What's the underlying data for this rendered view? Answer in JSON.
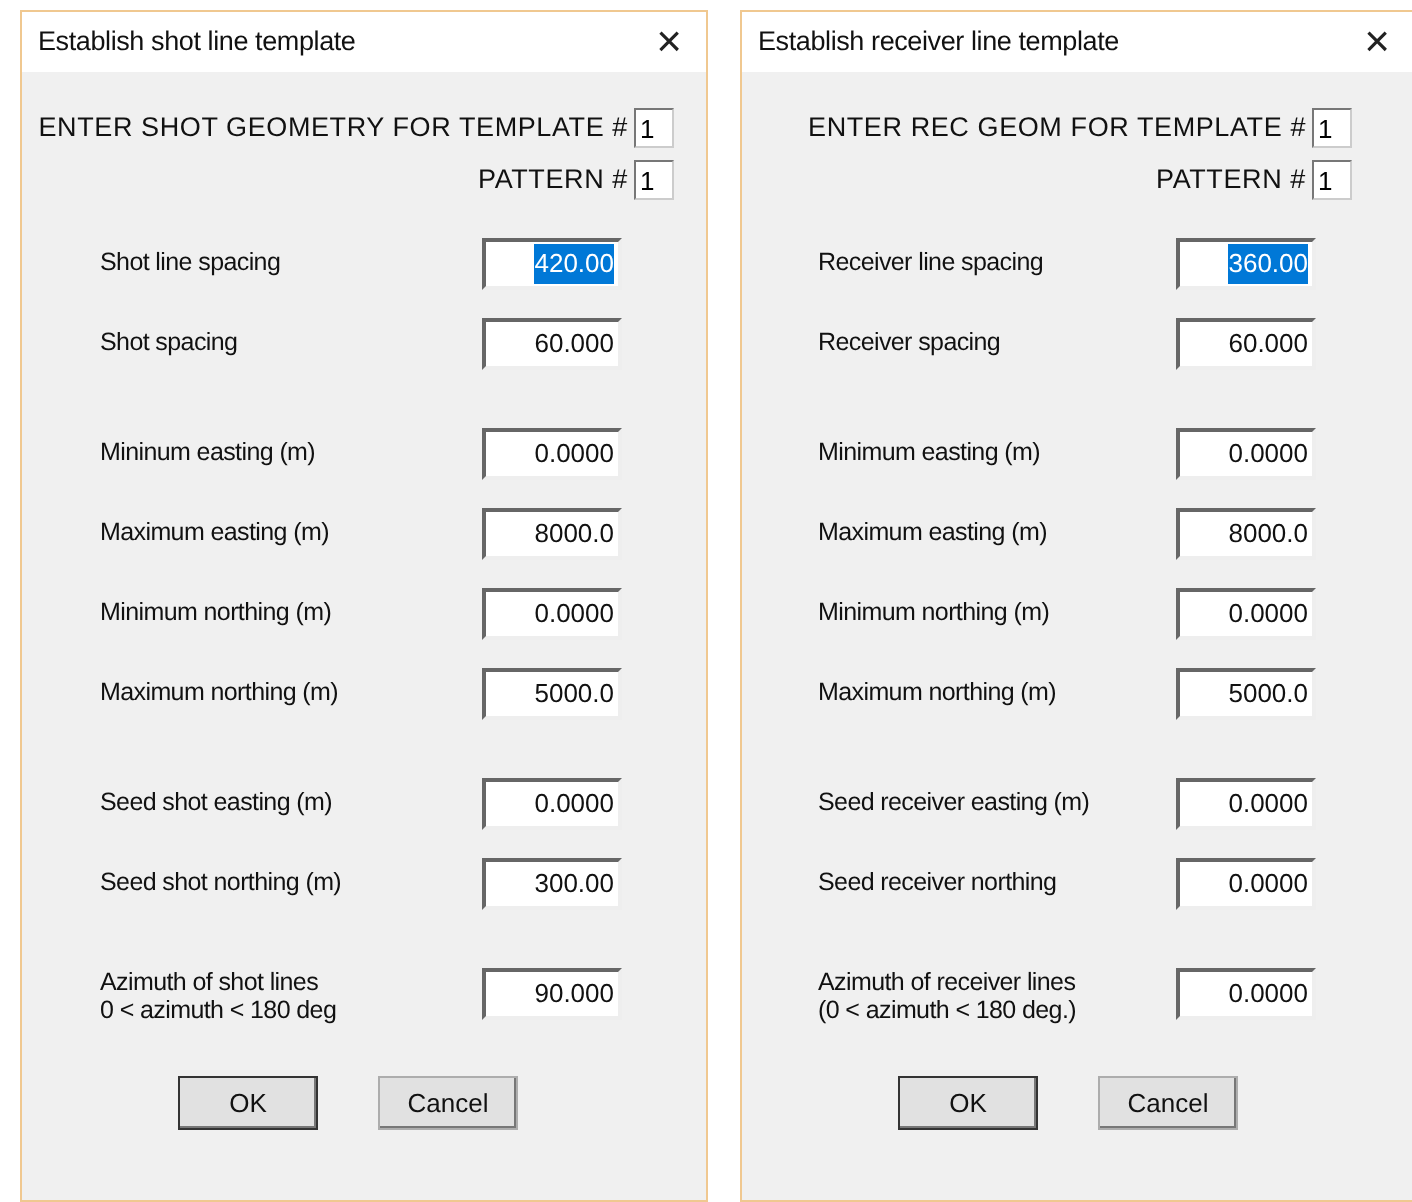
{
  "dialogs": [
    {
      "title": "Establish shot line template",
      "close": "×",
      "header": [
        {
          "label": "ENTER SHOT GEOMETRY FOR TEMPLATE #",
          "value": "1"
        },
        {
          "label": "PATTERN #",
          "value": "1"
        }
      ],
      "groups": [
        [
          {
            "label": "Shot line spacing",
            "value": "420.00",
            "selected": true
          },
          {
            "label": "Shot spacing",
            "value": "60.000",
            "selected": false
          }
        ],
        [
          {
            "label": "Mininum easting (m)",
            "value": "0.0000",
            "selected": false
          },
          {
            "label": "Maximum easting (m)",
            "value": "8000.0",
            "selected": false
          },
          {
            "label": "Minimum northing (m)",
            "value": "0.0000",
            "selected": false
          },
          {
            "label": "Maximum northing (m)",
            "value": "5000.0",
            "selected": false
          }
        ],
        [
          {
            "label": "Seed shot easting (m)",
            "value": "0.0000",
            "selected": false
          },
          {
            "label": "Seed shot northing (m)",
            "value": "300.00",
            "selected": false
          }
        ],
        [
          {
            "label": "Azimuth of shot lines\n0 < azimuth < 180 deg",
            "value": "90.000",
            "selected": false
          }
        ]
      ],
      "buttons": [
        {
          "label": "OK",
          "default": true
        },
        {
          "label": "Cancel",
          "default": false
        }
      ]
    },
    {
      "title": "Establish receiver line template",
      "close": "×",
      "header": [
        {
          "label": "ENTER REC GEOM FOR TEMPLATE #",
          "value": "1"
        },
        {
          "label": "PATTERN #",
          "value": "1"
        }
      ],
      "groups": [
        [
          {
            "label": "Receiver line spacing",
            "value": "360.00",
            "selected": true
          },
          {
            "label": "Receiver spacing",
            "value": "60.000",
            "selected": false
          }
        ],
        [
          {
            "label": "Minimum easting (m)",
            "value": "0.0000",
            "selected": false
          },
          {
            "label": "Maximum easting (m)",
            "value": "8000.0",
            "selected": false
          },
          {
            "label": "Minimum northing (m)",
            "value": "0.0000",
            "selected": false
          },
          {
            "label": "Maximum northing (m)",
            "value": "5000.0",
            "selected": false
          }
        ],
        [
          {
            "label": "Seed receiver easting (m)",
            "value": "0.0000",
            "selected": false
          },
          {
            "label": "Seed receiver northing",
            "value": "0.0000",
            "selected": false
          }
        ],
        [
          {
            "label": "Azimuth of receiver lines\n(0 < azimuth < 180 deg.)",
            "value": "0.0000",
            "selected": false
          }
        ]
      ],
      "buttons": [
        {
          "label": "OK",
          "default": true
        },
        {
          "label": "Cancel",
          "default": false
        }
      ]
    }
  ]
}
